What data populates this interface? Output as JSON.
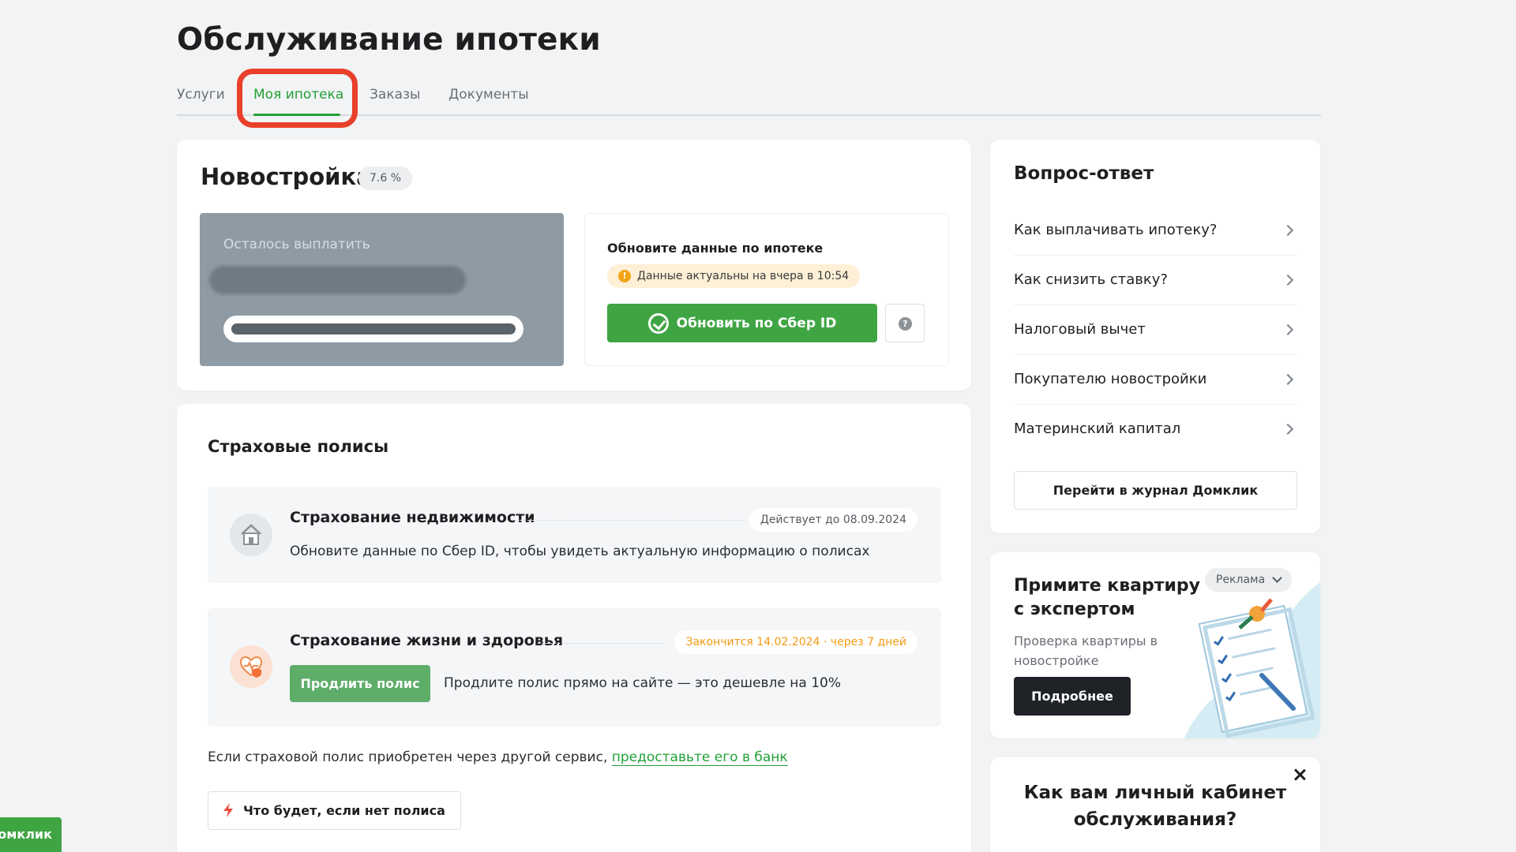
{
  "page": {
    "title": "Обслуживание ипотеки"
  },
  "tabs": [
    {
      "label": "Услуги",
      "active": false
    },
    {
      "label": "Моя ипотека",
      "active": true
    },
    {
      "label": "Заказы",
      "active": false
    },
    {
      "label": "Документы",
      "active": false
    }
  ],
  "mortgage": {
    "title": "Новостройка",
    "rate": "7.6 %",
    "balance_label": "Осталось выплатить",
    "update": {
      "title": "Обновите данные по ипотеке",
      "date_note": "Данные актуальны на вчера в 10:54",
      "button_label": "Обновить по Сбер ID",
      "help_symbol": "?"
    }
  },
  "policies": {
    "title": "Страховые полисы",
    "items": [
      {
        "name": "Страхование недвижимости",
        "status": "Действует до 08.09.2024",
        "note": "Обновите данные по Сбер ID, чтобы увидеть актуальную информацию о полисах"
      },
      {
        "name": "Страхование жизни и здоровья",
        "status": "Закончится 14.02.2024 · через 7 дней",
        "button_label": "Продлить полис",
        "note": "Продлите полис прямо на сайте — это дешевле на 10%"
      }
    ],
    "footnote_text": "Если страховой полис приобретен через другой сервис, ",
    "footnote_link": "предоставьте его в банк",
    "no_policy_button": "Что будет, если нет полиса"
  },
  "faq": {
    "title": "Вопрос-ответ",
    "items": [
      "Как выплачивать ипотеку?",
      "Как снизить ставку?",
      "Налоговый вычет",
      "Покупателю новостройки",
      "Материнский капитал"
    ],
    "journal_button": "Перейти в журнал Домклик"
  },
  "promo": {
    "title": "Примите квартиру с экспертом",
    "subtitle": "Проверка квартиры в новостройке",
    "button_label": "Подробнее",
    "ad_label": "Реклама"
  },
  "survey": {
    "title": "Как вам личный кабинет обслуживания?"
  },
  "side_tag": {
    "label": "Домклик"
  },
  "colors": {
    "accent_green": "#21a038",
    "button_green": "#3fa543",
    "warning_orange": "#f39a12",
    "highlight_red": "#e8402b"
  }
}
